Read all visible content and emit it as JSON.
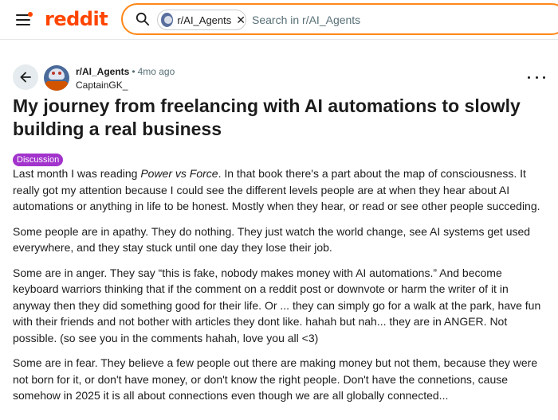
{
  "header": {
    "logo_text": "reddit",
    "search": {
      "chip_label": "r/AI_Agents",
      "chip_close": "✕",
      "placeholder": "Search in r/AI_Agents"
    }
  },
  "post": {
    "subreddit": "r/AI_Agents",
    "separator": "•",
    "time": "4mo ago",
    "author": "CaptainGK_",
    "title": "My journey from freelancing with AI automations to slowly building a real business",
    "flair": "Discussion",
    "body": {
      "p1_a": "Last month I was reading ",
      "p1_book": "Power vs Force",
      "p1_b": ". In that book there's a part about the map of consciousness. It really got my attention because I could see the different levels people are at when they hear about AI automations or anything in life to be honest. Mostly when they hear, or read or see other people succeding.",
      "p2": "Some people are in apathy. They do nothing. They just watch the world change, see AI systems get used everywhere, and they stay stuck until one day they lose their job.",
      "p3": "Some are in anger. They say “this is fake, nobody makes money with AI automations.” And become keyboard warriors thinking that if the comment on a reddit post or downvote or harm the writer of it in anyway then they did something good for their life. Or ... they can simply go for a walk at the park, have fun with their friends and not bother with articles they dont like. hahah but nah... they are in ANGER. Not possible. (so see you in the comments hahah, love you all <3)",
      "p4": "Some are in fear. They believe a few people out there are making money but not them, because they were not born for it, or don't have money, or don't know the right people. Don't have the connetions, cause somehow in 2025 it is all about connections even though we are all globally connected..."
    }
  },
  "colors": {
    "brand": "#ff4500",
    "search_border": "#ff8717",
    "flair_bg": "#a233cc",
    "meta_text": "#576f76"
  },
  "icons": {
    "menu": "hamburger-menu-icon",
    "search": "search-icon",
    "back": "arrow-left-icon",
    "overflow": "more-horizontal-icon"
  }
}
